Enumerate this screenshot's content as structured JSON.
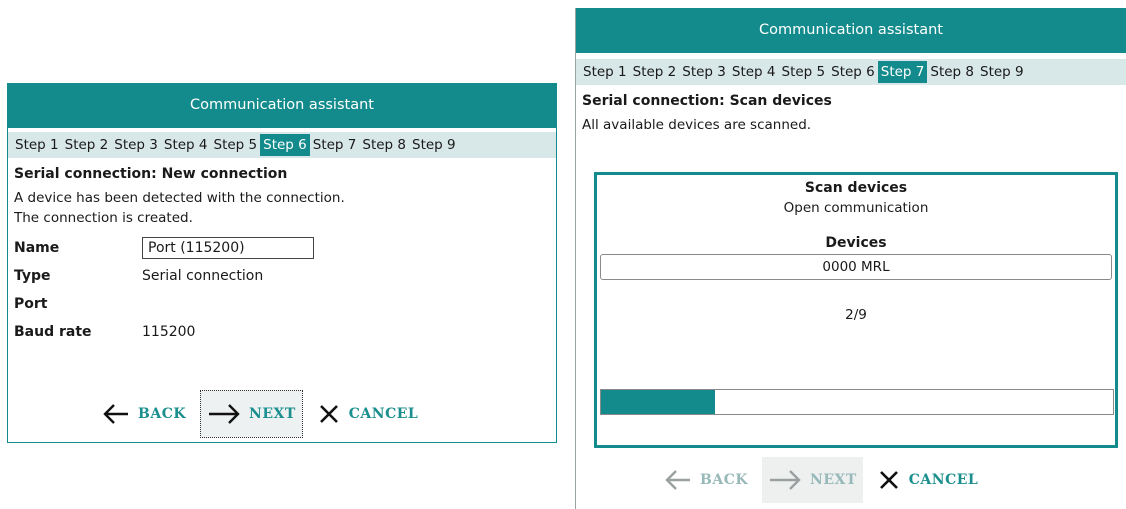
{
  "left_dialog": {
    "title": "Communication assistant",
    "steps": [
      "Step 1",
      "Step 2",
      "Step 3",
      "Step 4",
      "Step 5",
      "Step 6",
      "Step 7",
      "Step 8",
      "Step 9"
    ],
    "active_step": "Step 6",
    "section_title": "Serial connection: New connection",
    "description_line1": "A device has been detected with the connection.",
    "description_line2": "The connection is created.",
    "fields": {
      "name_label": "Name",
      "name_value": "Port (115200)",
      "type_label": "Type",
      "type_value": "Serial connection",
      "port_label": "Port",
      "port_value": "",
      "baud_label": "Baud rate",
      "baud_value": "115200"
    },
    "buttons": {
      "back": "BACK",
      "next": "NEXT",
      "cancel": "CANCEL"
    }
  },
  "right_dialog": {
    "title": "Communication assistant",
    "steps": [
      "Step 1",
      "Step 2",
      "Step 3",
      "Step 4",
      "Step 5",
      "Step 6",
      "Step 7",
      "Step 8",
      "Step 9"
    ],
    "active_step": "Step 7",
    "section_title": "Serial connection: Scan devices",
    "description": "All available devices are scanned.",
    "scan": {
      "heading": "Scan devices",
      "status": "Open communication",
      "devices_heading": "Devices",
      "device_value": "0000 MRL",
      "counter": "2/9",
      "progress_fraction": 0.222
    },
    "buttons": {
      "back": "BACK",
      "next": "NEXT",
      "cancel": "CANCEL"
    }
  },
  "colors": {
    "accent": "#138b8c",
    "step_bar": "#d8e7e8",
    "button_text": "#1a8f8e",
    "disabled_text": "#98b9b9"
  },
  "icons": {
    "back": "arrow-left-icon",
    "next": "arrow-right-icon",
    "cancel": "close-icon"
  }
}
